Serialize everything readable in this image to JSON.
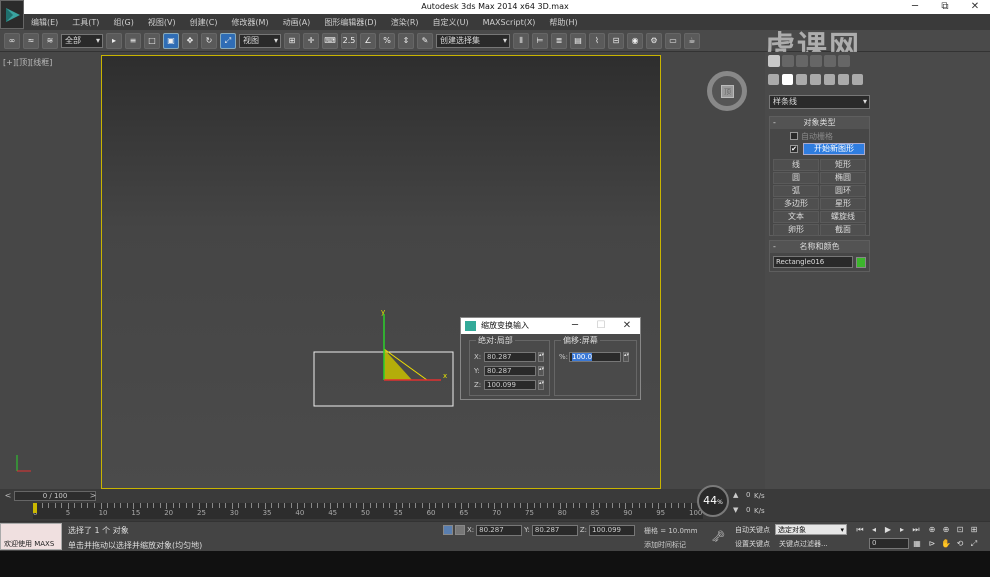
{
  "window": {
    "title": "Autodesk 3ds Max  2014 x64     3D.max",
    "min": "─",
    "max": "⧉",
    "close": "✕"
  },
  "menu": [
    "编辑(E)",
    "工具(T)",
    "组(G)",
    "视图(V)",
    "创建(C)",
    "修改器(M)",
    "动画(A)",
    "图形编辑器(D)",
    "渲染(R)",
    "自定义(U)",
    "MAXScript(X)",
    "帮助(H)"
  ],
  "toolbar": {
    "filter": "全部",
    "coord_system": "视图",
    "snap_label": "2.5",
    "named_selection": "创建选择集"
  },
  "watermark": "虎课网",
  "viewport": {
    "label": "[+][顶][线框]",
    "viewcube_face": "顶"
  },
  "command_panel": {
    "category": "样条线",
    "object_type_title": "对象类型",
    "auto_grid": "自动栅格",
    "start_shape_check": "✔",
    "start_shape": "开始新图形",
    "buttons": [
      "线",
      "矩形",
      "圆",
      "椭圆",
      "弧",
      "圆环",
      "多边形",
      "星形",
      "文本",
      "螺旋线",
      "卵形",
      "截面"
    ],
    "name_color_title": "名称和颜色",
    "object_name": "Rectangle016",
    "object_color": "#3cb52c"
  },
  "dialog": {
    "title": "缩放变换输入",
    "abs_group": "绝对:局部",
    "offset_group": "偏移:屏幕",
    "x_label": "X:",
    "x_value": "80.287",
    "y_label": "Y:",
    "y_value": "80.287",
    "z_label": "Z:",
    "z_value": "100.099",
    "pct_label": "%:",
    "pct_value": "100.0",
    "min": "─",
    "max": "☐",
    "close": "✕"
  },
  "timeline": {
    "frame_slider": "0 / 100",
    "ticks": [
      "0",
      "5",
      "10",
      "15",
      "20",
      "25",
      "30",
      "35",
      "40",
      "45",
      "50",
      "55",
      "60",
      "65",
      "70",
      "75",
      "80",
      "85",
      "90",
      "95",
      "100"
    ]
  },
  "fps": {
    "value": "44",
    "unit": "%",
    "rate_up": "0",
    "rate_down": "0",
    "rate_unit": "K/s"
  },
  "status": {
    "welcome": "欢迎使用 MAXS",
    "selected": "选择了 1 个 对象",
    "prompt": "单击并拖动以选择并缩放对象(均匀地)",
    "x_label": "X:",
    "x_value": "80.287",
    "y_label": "Y:",
    "y_value": "80.287",
    "z_label": "Z:",
    "z_value": "100.099",
    "grid": "栅格 = 10.0mm",
    "add_time_tag": "添加时间标记",
    "auto_key": "自动关键点",
    "set_key": "设置关键点",
    "selection_dropdown": "选定对象",
    "key_filters": "关键点过滤器...",
    "frame_value": "0"
  }
}
